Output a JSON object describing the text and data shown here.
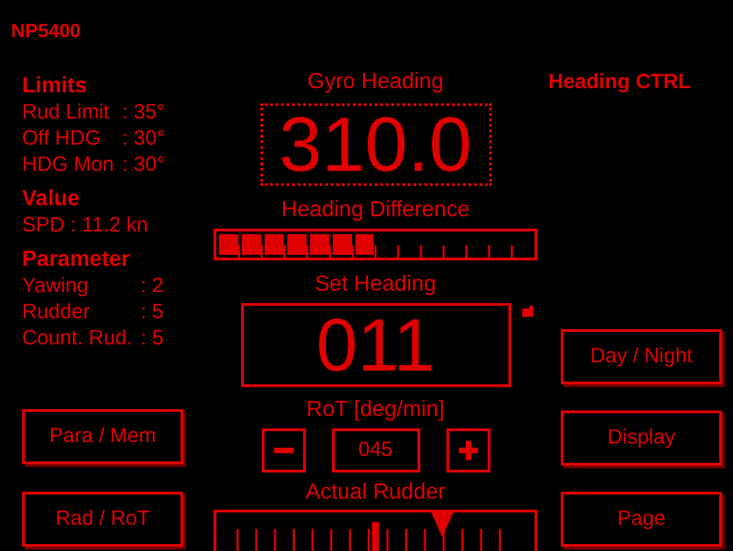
{
  "app_title": "NP5400",
  "limits": {
    "title": "Limits",
    "items": [
      {
        "label": "Rud Limit",
        "value": ": 35°"
      },
      {
        "label": "Off HDG",
        "value": ": 30°"
      },
      {
        "label": "HDG Mon",
        "value": ": 30°"
      }
    ]
  },
  "value": {
    "title": "Value",
    "items": [
      "SPD : 11.2 kn"
    ]
  },
  "parameter": {
    "title": "Parameter",
    "items": [
      {
        "label": "Yawing",
        "value": ": 2"
      },
      {
        "label": "Rudder",
        "value": ": 5"
      },
      {
        "label": "Count. Rud.",
        "value": ": 5"
      }
    ]
  },
  "left_buttons": [
    "Para / Mem",
    "Rad / RoT"
  ],
  "gyro_heading": {
    "label": "Gyro Heading",
    "value": "310.0"
  },
  "heading_difference": {
    "label": "Heading Difference",
    "level": 0.5
  },
  "set_heading": {
    "label": "Set Heading",
    "value": "011"
  },
  "rot": {
    "label": "RoT [deg/min]",
    "value": "045"
  },
  "actual_rudder": {
    "label": "Actual Rudder",
    "level": 0.71
  },
  "heading_ctrl": {
    "title": "Heading CTRL",
    "buttons": [
      "Day / Night",
      "Display",
      "Page"
    ]
  }
}
